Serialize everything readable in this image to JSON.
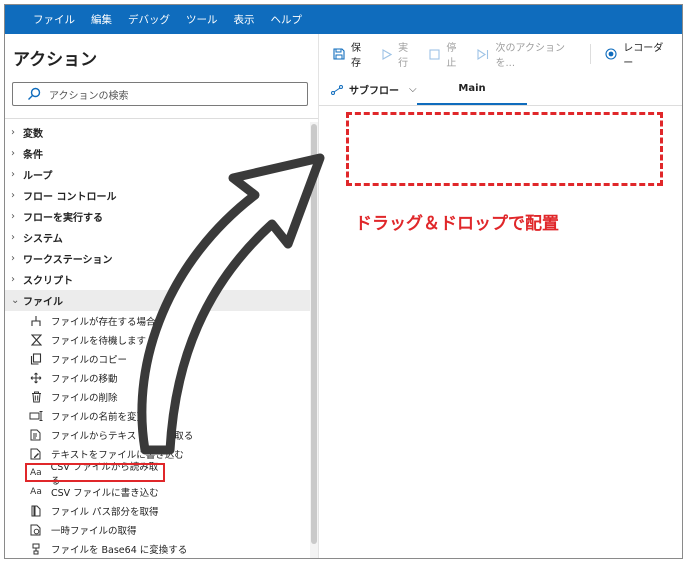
{
  "menubar": {
    "items": [
      "ファイル",
      "編集",
      "デバッグ",
      "ツール",
      "表示",
      "ヘルプ"
    ]
  },
  "actions_pane": {
    "title": "アクション",
    "search_placeholder": "アクションの検索",
    "categories": [
      "変数",
      "条件",
      "ループ",
      "フロー コントロール",
      "フローを実行する",
      "システム",
      "ワークステーション",
      "スクリプト"
    ],
    "open_category": "ファイル",
    "file_actions": [
      {
        "label": "ファイルが存在する場合",
        "icon": "branch-icon"
      },
      {
        "label": "ファイルを待機します",
        "icon": "hourglass-icon"
      },
      {
        "label": "ファイルのコピー",
        "icon": "copy-icon"
      },
      {
        "label": "ファイルの移動",
        "icon": "move-icon"
      },
      {
        "label": "ファイルの削除",
        "icon": "trash-icon"
      },
      {
        "label": "ファイルの名前を変更",
        "icon": "rename-icon"
      },
      {
        "label": "ファイルからテキストを読み取る",
        "icon": "read-text-icon"
      },
      {
        "label": "テキストをファイルに書き込む",
        "icon": "write-text-icon"
      },
      {
        "label": "CSV ファイルから読み取る",
        "icon": "text-aa-icon"
      },
      {
        "label": "CSV ファイルに書き込む",
        "icon": "text-aa-icon"
      },
      {
        "label": "ファイル パス部分を取得",
        "icon": "file-path-icon"
      },
      {
        "label": "一時ファイルの取得",
        "icon": "temp-file-icon"
      },
      {
        "label": "ファイルを Base64 に変換する",
        "icon": "base64-icon"
      }
    ],
    "highlighted_action": "CSV ファイルから読み取る"
  },
  "toolbar": {
    "save": "保存",
    "run": "実行",
    "stop": "停止",
    "next_action": "次のアクションを...",
    "recorder": "レコーダー"
  },
  "tabs": {
    "subflow": "サブフロー",
    "main": "Main"
  },
  "annotation": {
    "text": "ドラッグ＆ドロップで配置"
  },
  "colors": {
    "menubar": "#0f6cbd",
    "annotation": "#e0272a",
    "arrow": "#3a3a3a"
  }
}
